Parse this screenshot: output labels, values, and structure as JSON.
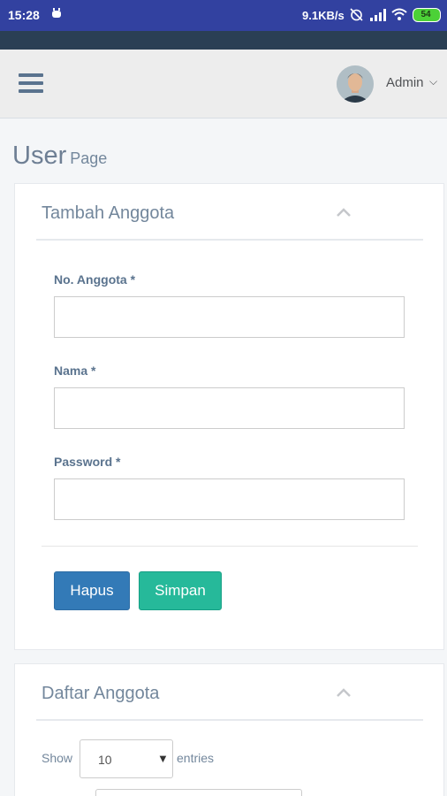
{
  "status_bar": {
    "time": "15:28",
    "network_speed": "9.1KB/s",
    "battery": "54",
    "icons": [
      "bug-notification-icon",
      "alarm-off-icon",
      "signal-icon",
      "wifi-icon",
      "battery-icon"
    ]
  },
  "colors": {
    "status_bar": "#3241a0",
    "sidebar_dark": "#2a3f54",
    "btn_primary": "#337ab7",
    "btn_success": "#26b99a"
  },
  "header": {
    "menu_icon": "hamburger-menu-icon",
    "user_name": "Admin",
    "user_caret": "⌵"
  },
  "page": {
    "title": "User",
    "subtitle": "Page"
  },
  "form_panel": {
    "title": "Tambah Anggota",
    "collapse_icon": "chevron-up-icon",
    "fields": [
      {
        "label": "No. Anggota *",
        "value": ""
      },
      {
        "label": "Nama *",
        "value": ""
      },
      {
        "label": "Password *",
        "value": ""
      }
    ],
    "buttons": {
      "reset_label": "Hapus",
      "submit_label": "Simpan"
    }
  },
  "list_panel": {
    "title": "Daftar Anggota",
    "collapse_icon": "chevron-up-icon",
    "show_label": "Show",
    "entries_value": "10",
    "entries_caret": "▼",
    "entries_label": "entries"
  }
}
